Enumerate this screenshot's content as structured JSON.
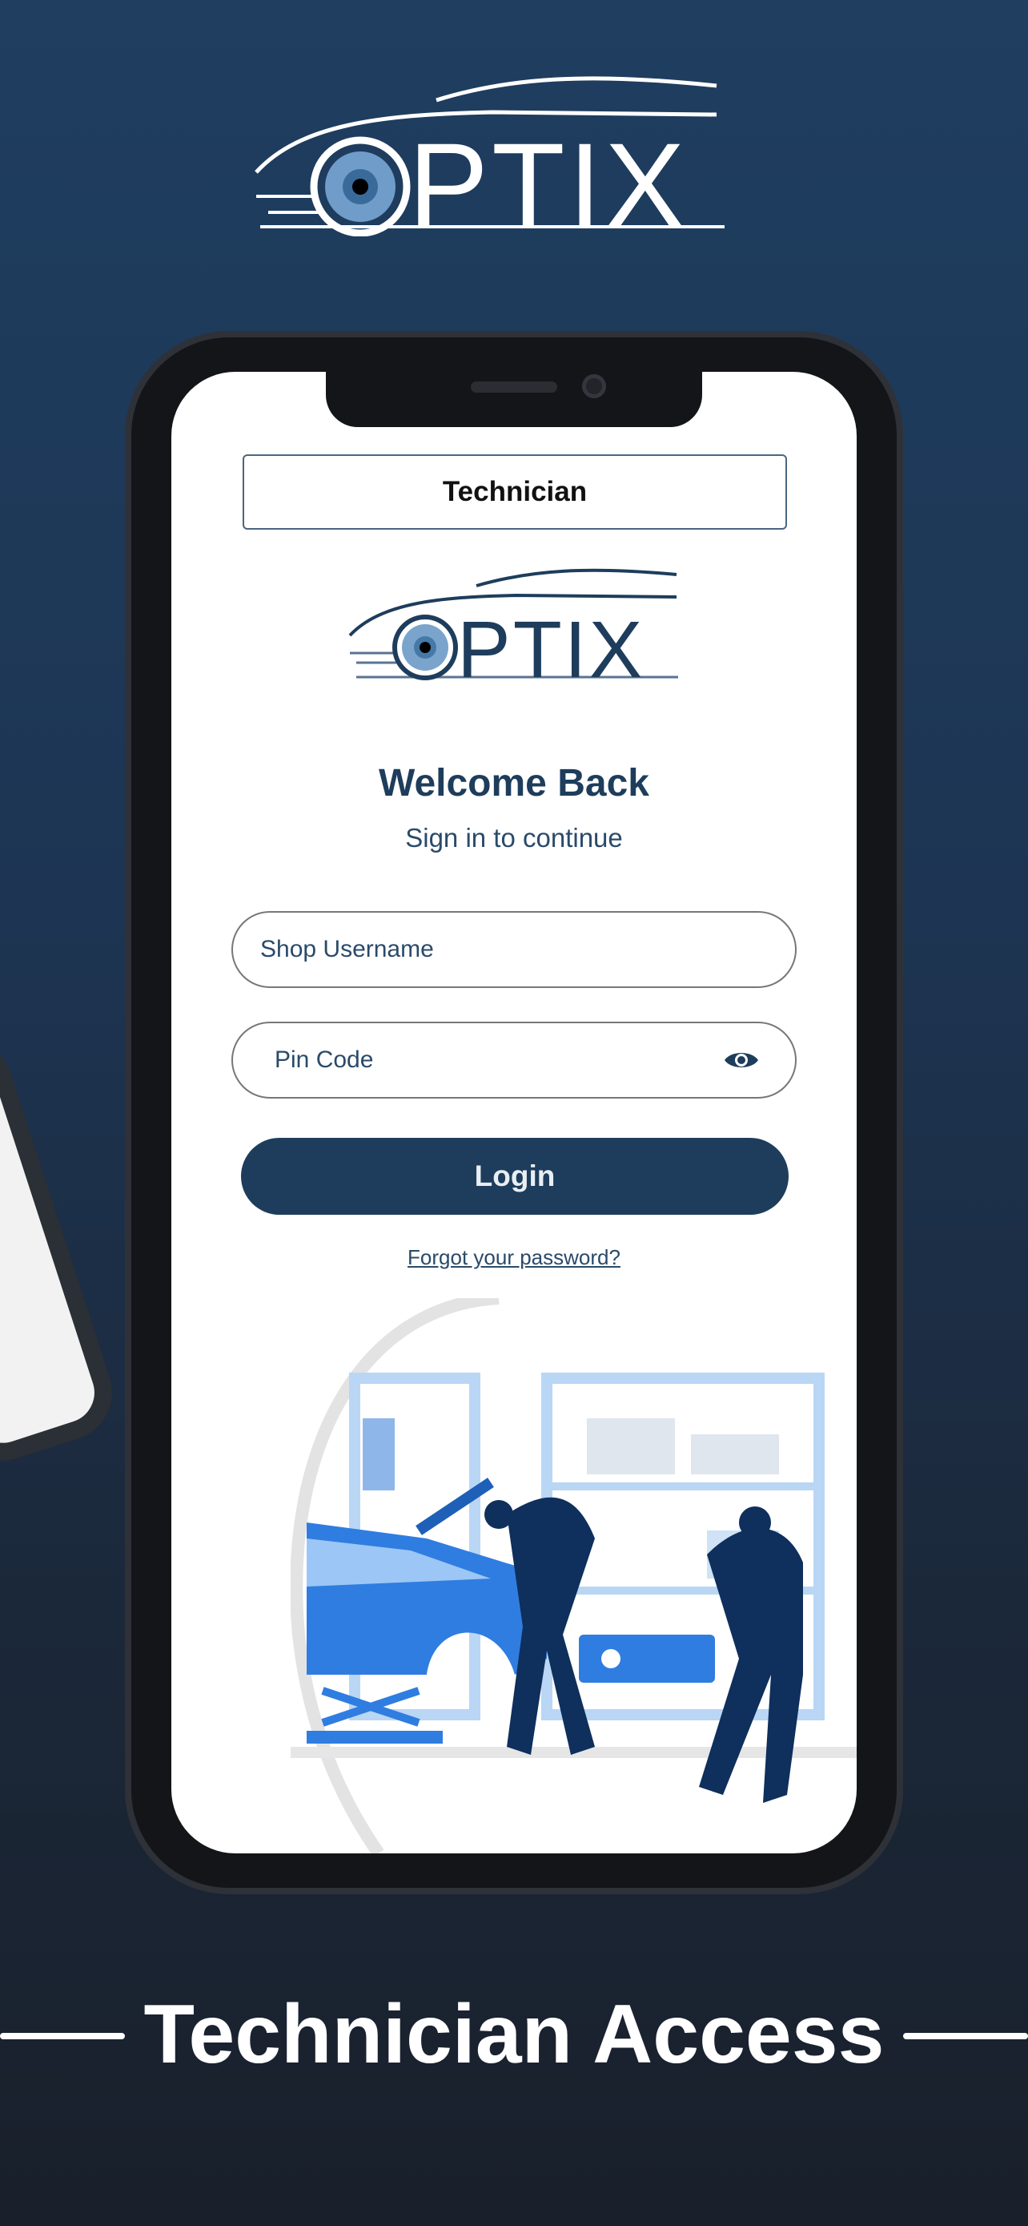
{
  "brand": {
    "logo_text": "OPTIX"
  },
  "login_screen": {
    "role_selector": "Technician",
    "title": "Welcome Back",
    "subtitle": "Sign in to continue",
    "username_placeholder": "Shop Username",
    "pin_placeholder": "Pin Code",
    "pin_toggle_icon": "eye-icon",
    "login_label": "Login",
    "forgot_label": "Forgot your password?"
  },
  "caption": "Technician Access",
  "colors": {
    "primary": "#1e3d5c",
    "background_top": "#1f3e60",
    "background_bottom": "#19202b",
    "illustration": "#2f7de0"
  }
}
